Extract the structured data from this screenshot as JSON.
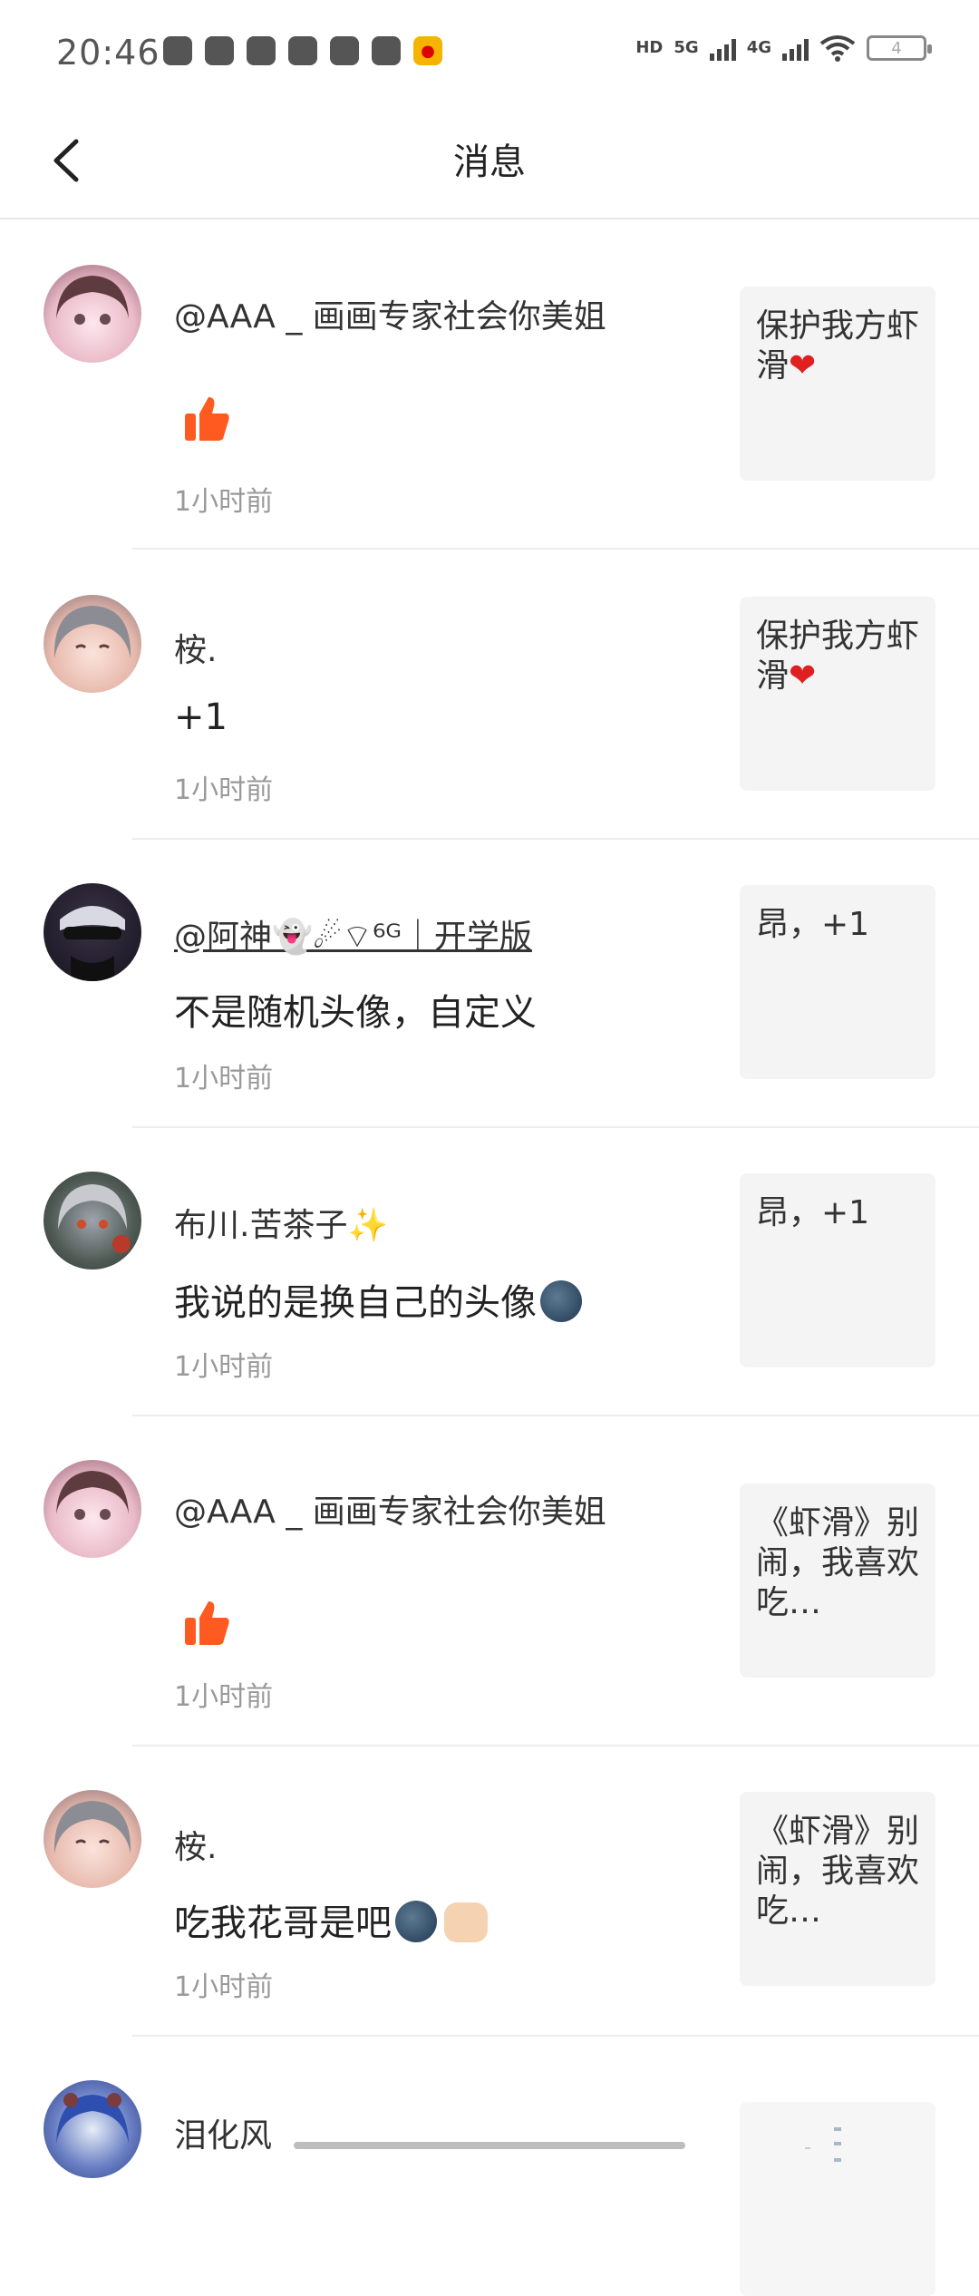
{
  "status_bar": {
    "time": "20:46",
    "signal_labels": [
      "HD",
      "5G",
      "4G"
    ],
    "battery_level": "4"
  },
  "header": {
    "title": "消息"
  },
  "messages": [
    {
      "name": "@AAA _ 画画专家社会你美姐",
      "content": "",
      "content_type": "like",
      "time": "1小时前",
      "quote": "保护我方虾滑❤️"
    },
    {
      "name": "桉.",
      "content": "+1",
      "content_type": "text",
      "time": "1小时前",
      "quote": "保护我方虾滑❤️"
    },
    {
      "name": "@阿神👻☄︎⌔⁶ᴳ｜开学版",
      "content": "不是随机头像，自定义",
      "content_type": "text",
      "time": "1小时前",
      "quote": "昂，+1"
    },
    {
      "name": "布川.苦茶子✨",
      "content": "我说的是换自己的头像",
      "content_type": "text_moon",
      "time": "1小时前",
      "quote": "昂，+1"
    },
    {
      "name": "@AAA _ 画画专家社会你美姐",
      "content": "",
      "content_type": "like",
      "time": "1小时前",
      "quote": "《虾滑》别闹，我喜欢吃…"
    },
    {
      "name": "桉.",
      "content": "吃我花哥是吧",
      "content_type": "text_moon_fist",
      "time": "1小时前",
      "quote": "《虾滑》别闹，我喜欢吃…"
    },
    {
      "name": "泪化风",
      "content": "",
      "content_type": "partial",
      "time": "",
      "quote": ""
    }
  ],
  "colors": {
    "like": "#ff5a1f",
    "time": "#999999",
    "quote_bg": "#f4f4f4"
  }
}
